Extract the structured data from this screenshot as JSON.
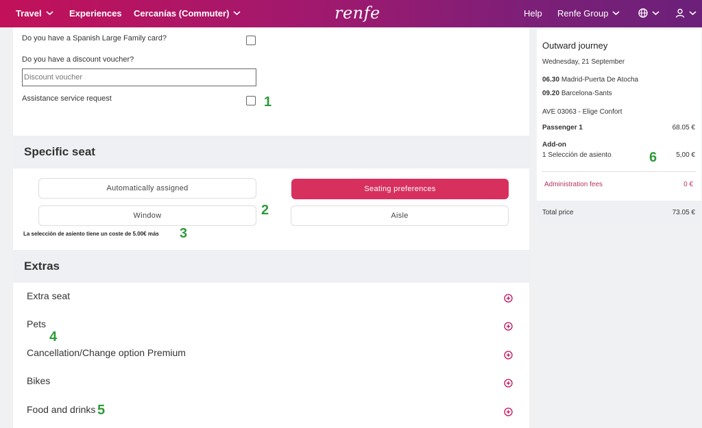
{
  "nav": {
    "travel": "Travel",
    "experiences": "Experiences",
    "commuter": "Cercanías (Commuter)",
    "logo": "renfe",
    "help": "Help",
    "group": "Renfe Group"
  },
  "form": {
    "large_family_label": "Do you have a Spanish Large Family card?",
    "voucher_label": "Do you have a discount voucher?",
    "voucher_placeholder": "Discount voucher",
    "assistance_label": "Assistance service request"
  },
  "seat": {
    "heading": "Specific seat",
    "auto": "Automatically assigned",
    "preferences": "Seating preferences",
    "window": "Window",
    "aisle": "Aisle",
    "note": "La selección de asiento tiene un coste de 5.00€ más"
  },
  "extras": {
    "heading": "Extras",
    "items": [
      "Extra seat",
      "Pets",
      "Cancellation/Change option Premium",
      "Bikes",
      "Food and drinks"
    ]
  },
  "annotations": [
    "1",
    "2",
    "3",
    "4",
    "5",
    "6"
  ],
  "summary": {
    "title": "Outward journey",
    "date": "Wednesday, 21 September",
    "dep_time": "06.30",
    "dep_station": "Madrid-Puerta De Atocha",
    "arr_time": "09.20",
    "arr_station": "Barcelona-Sants",
    "train": "AVE 03063 - Elige Confort",
    "passenger_label": "Passenger 1",
    "passenger_price": "68.05 €",
    "addon_label": "Add-on",
    "addon_item": "1 Selección de asiento",
    "addon_price": "5,00 €",
    "fees_label": "Administration fees",
    "fees_price": "0 €",
    "total_label": "Total price",
    "total_price": "73.05 €"
  },
  "colors": {
    "brand": "#c2115a",
    "accent": "#d7305f",
    "annotation": "#2e9a3a"
  }
}
